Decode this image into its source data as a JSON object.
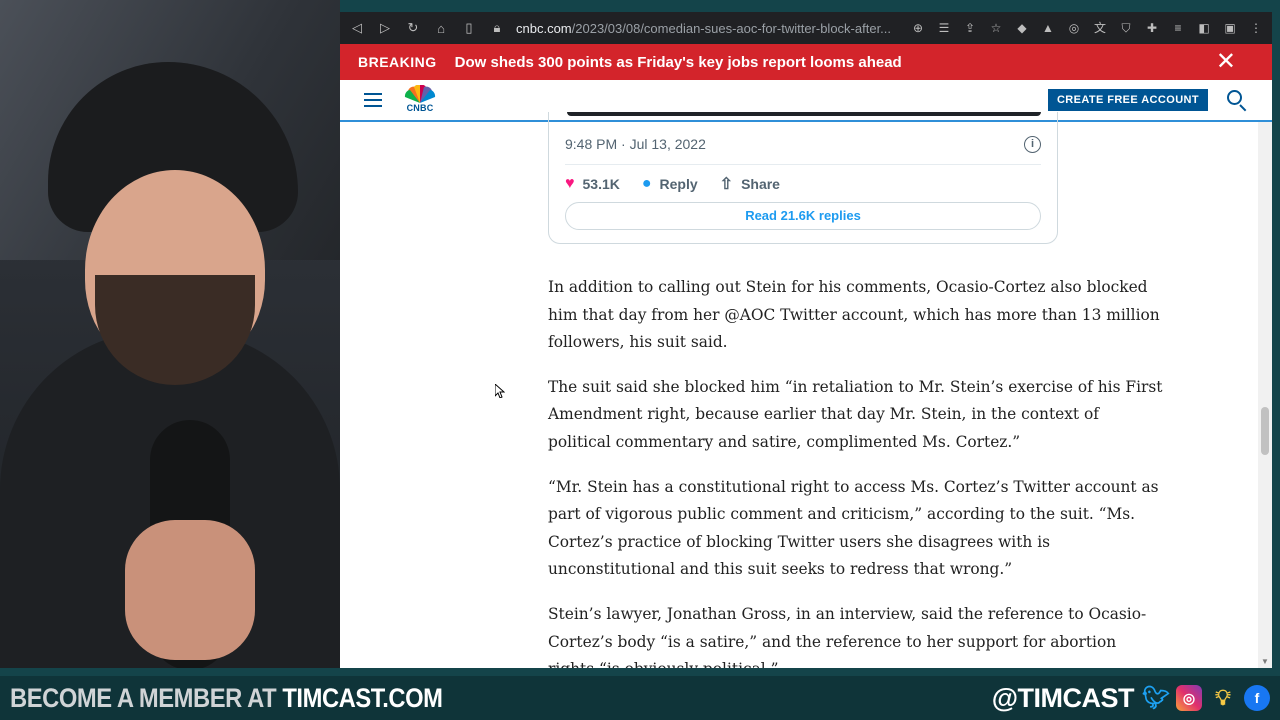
{
  "browser": {
    "url_host": "cnbc.com",
    "url_path": "/2023/03/08/comedian-sues-aoc-for-twitter-block-after..."
  },
  "breaking": {
    "tag": "BREAKING",
    "headline": "Dow sheds 300 points as Friday's key jobs report looms ahead"
  },
  "header": {
    "logo_text": "CNBC",
    "cta_label": "CREATE FREE ACCOUNT"
  },
  "tweet": {
    "timestamp": "9:48 PM · Jul 13, 2022",
    "likes": "53.1K",
    "reply_label": "Reply",
    "share_label": "Share",
    "read_replies": "Read 21.6K replies"
  },
  "article": {
    "paragraphs": [
      "In addition to calling out Stein for his comments, Ocasio-Cortez also blocked him that day from her @AOC Twitter account, which has more than 13 million followers, his suit said.",
      "The suit said she blocked him “in retaliation to Mr. Stein’s exercise of his First Amendment right, because earlier that day Mr. Stein, in the context of political commentary and satire, complimented Ms. Cortez.”",
      "“Mr. Stein has a constitutional right to access Ms. Cortez’s Twitter account as part of vigorous public comment and criticism,” according to the suit. “Ms. Cortez’s practice of blocking Twitter users she disagrees with is unconstitutional and this suit seeks to redress that wrong.”",
      "Stein’s lawyer, Jonathan Gross, in an interview, said the reference to Ocasio-Cortez’s body “is a satire,” and the reference to her support for abortion rights “is obviously political.”"
    ]
  },
  "banner": {
    "cta_prefix": "BECOME A MEMBER AT ",
    "cta_site": "TIMCAST.COM",
    "handle": "@TIMCAST"
  }
}
